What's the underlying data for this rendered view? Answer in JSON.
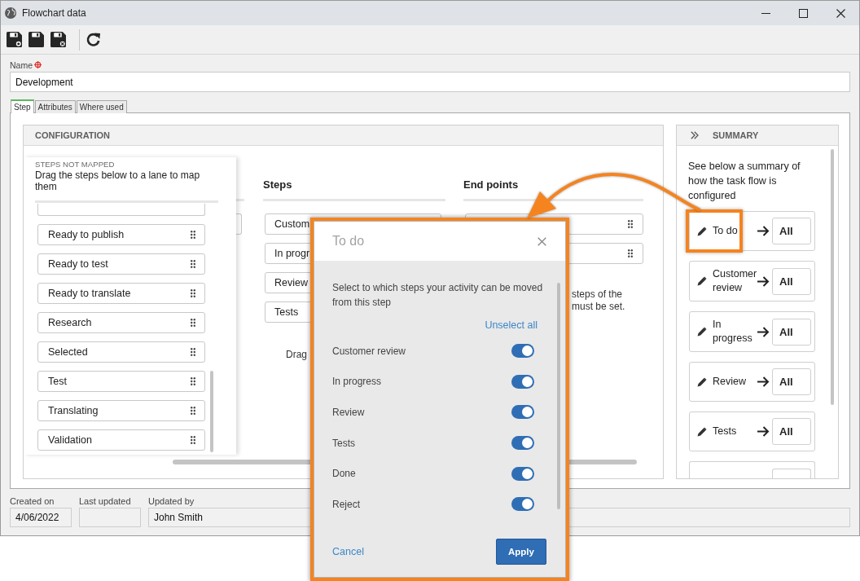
{
  "window": {
    "title": "Flowchart data"
  },
  "name_field": {
    "label": "Name",
    "required": true,
    "value": "Development"
  },
  "tabs": [
    {
      "label": "Step",
      "selected": true
    },
    {
      "label": "Attributes",
      "selected": false
    },
    {
      "label": "Where used",
      "selected": false
    }
  ],
  "configuration": {
    "title": "CONFIGURATION",
    "steps_not_mapped": {
      "title": "STEPS NOT MAPPED",
      "hint": "Drag the steps below to a lane to map them",
      "items": [
        {
          "kind": "cut_off"
        },
        {
          "kind": "step",
          "label": "Ready to publish"
        },
        {
          "kind": "step",
          "label": "Ready to test"
        },
        {
          "kind": "step",
          "label": "Ready to translate"
        },
        {
          "kind": "step",
          "label": "Research"
        },
        {
          "kind": "step",
          "label": "Selected"
        },
        {
          "kind": "step",
          "label": "Test"
        },
        {
          "kind": "step",
          "label": "Translating"
        },
        {
          "kind": "step",
          "label": "Validation"
        }
      ]
    },
    "lanes": [
      {
        "kind": "cut_off"
      },
      {
        "kind": "lane",
        "title": "Steps",
        "items": [
          {
            "kind": "text",
            "label": "Custom"
          },
          {
            "kind": "text",
            "label": "In progr"
          },
          {
            "kind": "text",
            "label": "Review"
          },
          {
            "kind": "text",
            "label": "Tests"
          }
        ],
        "drop_hint": "Drag"
      },
      {
        "kind": "lane",
        "title": "End points",
        "items": [
          {
            "kind": "handle_only"
          },
          {
            "kind": "handle_only"
          }
        ],
        "note_lines": [
          "steps of the",
          "must be set."
        ]
      }
    ]
  },
  "summary": {
    "title": "SUMMARY",
    "description": "See below a summary of how the task flow is configured",
    "items": [
      {
        "kind": "step",
        "label": "To do",
        "target": "All",
        "highlighted": true
      },
      {
        "kind": "step",
        "label": "Customer review",
        "target": "All",
        "highlighted": false
      },
      {
        "kind": "step",
        "label": "In progress",
        "target": "All",
        "highlighted": false
      },
      {
        "kind": "step",
        "label": "Review",
        "target": "All",
        "highlighted": false
      },
      {
        "kind": "step",
        "label": "Tests",
        "target": "All",
        "highlighted": false
      },
      {
        "kind": "cut_off"
      }
    ]
  },
  "details": [
    {
      "label": "Created on",
      "value": "4/06/2022"
    },
    {
      "label": "Last updated"
    },
    {
      "label": "Updated by",
      "value": "John Smith"
    }
  ],
  "dialog": {
    "title": "To do",
    "highlighted": true,
    "description": "Select to which steps your activity can be moved from this step",
    "unselect_all": "Unselect all",
    "options": [
      {
        "label": "Customer review",
        "on": true
      },
      {
        "label": "In progress",
        "on": true
      },
      {
        "label": "Review",
        "on": true
      },
      {
        "label": "Tests",
        "on": true
      },
      {
        "label": "Done",
        "on": true
      },
      {
        "label": "Reject",
        "on": true
      }
    ],
    "cancel": "Cancel",
    "apply": "Apply"
  },
  "callout_arrow": true
}
